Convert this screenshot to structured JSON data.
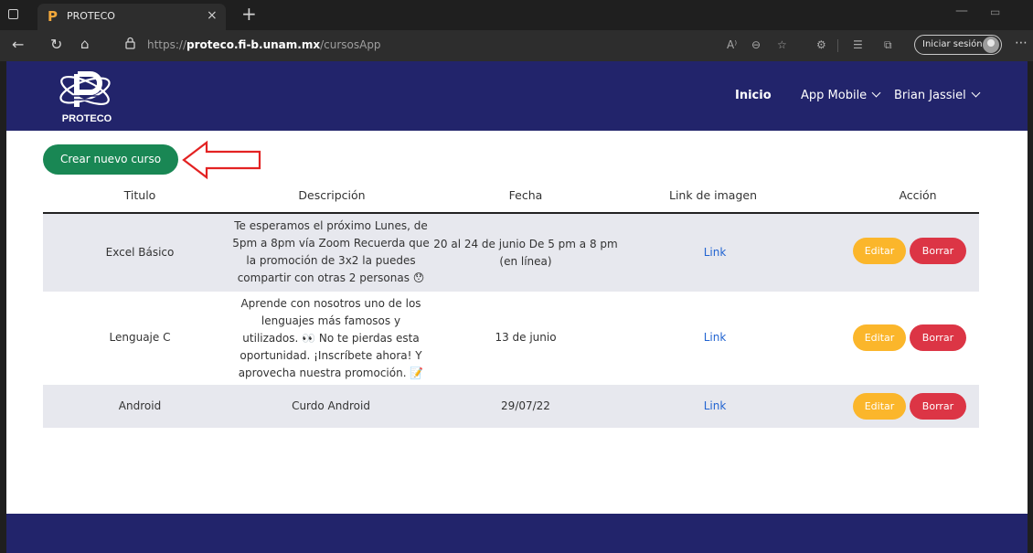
{
  "browser": {
    "tab": {
      "favicon": "P",
      "title": "PROTECO",
      "close": "×"
    },
    "new_tab": "+",
    "url": {
      "prefix": "https://",
      "domain": "proteco.fi-b.unam.mx",
      "path": "/cursosApp"
    },
    "read_aloud": "A⁾",
    "signin_label": "Iniciar sesión"
  },
  "navbar": {
    "logo_text": "PROTECO",
    "links": {
      "inicio": "Inicio",
      "app_mobile": "App Mobile",
      "user": "Brian Jassiel"
    }
  },
  "main": {
    "create_button": "Crear nuevo curso",
    "headers": {
      "titulo": "Titulo",
      "descripcion": "Descripción",
      "fecha": "Fecha",
      "link": "Link de imagen",
      "accion": "Acción"
    },
    "rows": [
      {
        "titulo": "Excel Básico",
        "descripcion": [
          "Te esperamos el próximo Lunes, de",
          "5pm a 8pm vía Zoom Recuerda que",
          "la promoción de 3x2 la puedes",
          "compartir con otras 2 personas 😯"
        ],
        "fecha": [
          "20 al 24 de junio De 5 pm a 8 pm",
          "(en línea)"
        ],
        "link": "Link",
        "editar": "Editar",
        "borrar": "Borrar"
      },
      {
        "titulo": "Lenguaje C",
        "descripcion": [
          "Aprende con nosotros uno de los",
          "lenguajes más famosos y",
          "utilizados. 👀 No te pierdas esta",
          "oportunidad. ¡Inscríbete ahora! Y",
          "aprovecha nuestra promoción. 📝"
        ],
        "fecha": [
          "13 de junio"
        ],
        "link": "Link",
        "editar": "Editar",
        "borrar": "Borrar"
      },
      {
        "titulo": "Android",
        "descripcion": [
          "Curdo Android"
        ],
        "fecha": [
          "29/07/22"
        ],
        "link": "Link",
        "editar": "Editar",
        "borrar": "Borrar"
      }
    ]
  },
  "colors": {
    "navbar": "#22246b",
    "create": "#198754",
    "edit": "#fbb62b",
    "delete": "#dc3545",
    "link": "#2264d1",
    "row_shade": "#e7e8ee"
  }
}
